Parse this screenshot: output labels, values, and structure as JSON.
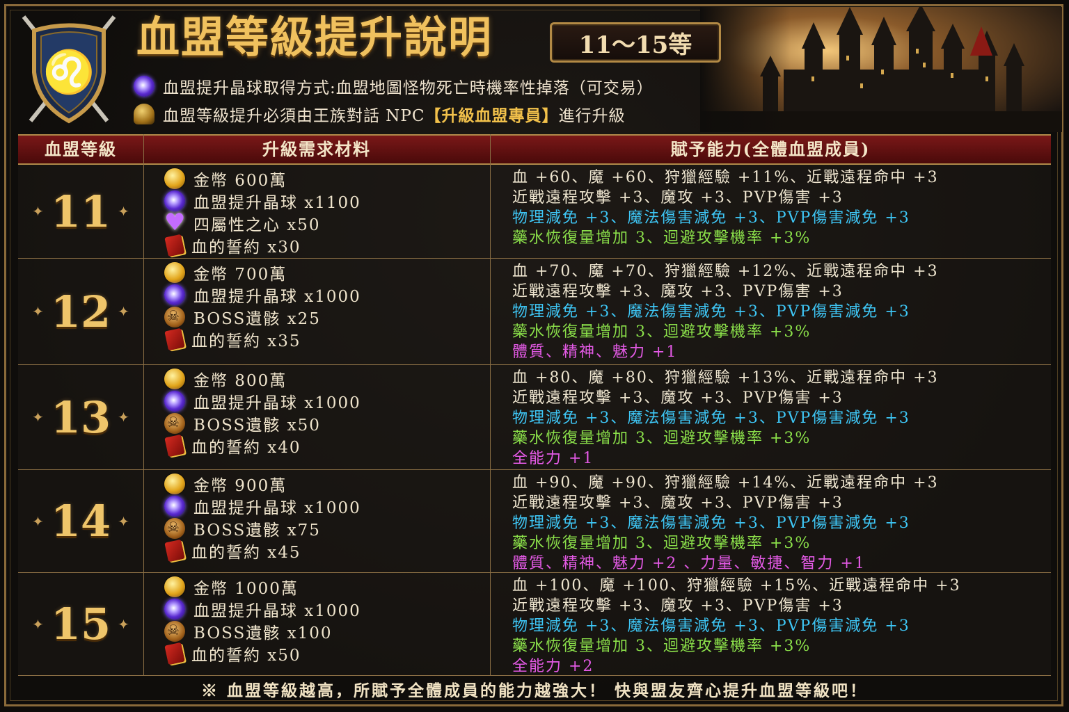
{
  "header": {
    "title": "血盟等級提升說明",
    "range_badge": "11～15等",
    "notes": [
      {
        "icon": "purple-orb-icon",
        "text": "血盟提升晶球取得方式:血盟地圖怪物死亡時機率性掉落（可交易）"
      },
      {
        "icon": "helmet-icon",
        "text_before": "血盟等級提升必須由王族對話 NPC",
        "highlight": "【升級血盟專員】",
        "text_after": " 進行升級"
      }
    ]
  },
  "table": {
    "headers": [
      "血盟等級",
      "升級需求材料",
      "賦予能力(全體血盟成員)"
    ],
    "rows": [
      {
        "level": "11",
        "materials": [
          {
            "icon": "gold-coin-icon",
            "text": "金幣 600萬"
          },
          {
            "icon": "purple-orb-icon",
            "text": "血盟提升晶球 x1100"
          },
          {
            "icon": "heart-gem-icon",
            "text": "四屬性之心 x50"
          },
          {
            "icon": "red-book-icon",
            "text": "血的誓約 x30"
          }
        ],
        "abilities": [
          {
            "color": "white",
            "text": "血 +60、魔 +60、狩獵經驗 +11%、近戰遠程命中 +3"
          },
          {
            "color": "white",
            "text": "近戰遠程攻擊 +3、魔攻 +3、PVP傷害 +3"
          },
          {
            "color": "blue",
            "text": "物理減免 +3、魔法傷害減免 +3、PVP傷害減免 +3"
          },
          {
            "color": "green",
            "text": "藥水恢復量增加 3、迴避攻擊機率 +3%"
          }
        ]
      },
      {
        "level": "12",
        "materials": [
          {
            "icon": "gold-coin-icon",
            "text": "金幣 700萬"
          },
          {
            "icon": "purple-orb-icon",
            "text": "血盟提升晶球 x1000"
          },
          {
            "icon": "skull-icon",
            "text": "BOSS遺骸 x25"
          },
          {
            "icon": "red-book-icon",
            "text": "血的誓約 x35"
          }
        ],
        "abilities": [
          {
            "color": "white",
            "text": "血 +70、魔 +70、狩獵經驗 +12%、近戰遠程命中 +3"
          },
          {
            "color": "white",
            "text": "近戰遠程攻擊 +3、魔攻 +3、PVP傷害 +3"
          },
          {
            "color": "blue",
            "text": "物理減免 +3、魔法傷害減免 +3、PVP傷害減免 +3"
          },
          {
            "color": "green",
            "text": "藥水恢復量增加 3、迴避攻擊機率 +3%"
          },
          {
            "color": "pink",
            "text": "體質、精神、魅力 +1"
          }
        ]
      },
      {
        "level": "13",
        "materials": [
          {
            "icon": "gold-coin-icon",
            "text": "金幣 800萬"
          },
          {
            "icon": "purple-orb-icon",
            "text": "血盟提升晶球 x1000"
          },
          {
            "icon": "skull-icon",
            "text": "BOSS遺骸 x50"
          },
          {
            "icon": "red-book-icon",
            "text": "血的誓約 x40"
          }
        ],
        "abilities": [
          {
            "color": "white",
            "text": "血 +80、魔 +80、狩獵經驗 +13%、近戰遠程命中 +3"
          },
          {
            "color": "white",
            "text": "近戰遠程攻擊 +3、魔攻 +3、PVP傷害 +3"
          },
          {
            "color": "blue",
            "text": "物理減免 +3、魔法傷害減免 +3、PVP傷害減免 +3"
          },
          {
            "color": "green",
            "text": "藥水恢復量增加 3、迴避攻擊機率 +3%"
          },
          {
            "color": "pink",
            "text": "全能力 +1"
          }
        ]
      },
      {
        "level": "14",
        "materials": [
          {
            "icon": "gold-coin-icon",
            "text": "金幣 900萬"
          },
          {
            "icon": "purple-orb-icon",
            "text": "血盟提升晶球 x1000"
          },
          {
            "icon": "skull-icon",
            "text": "BOSS遺骸 x75"
          },
          {
            "icon": "red-book-icon",
            "text": "血的誓約 x45"
          }
        ],
        "abilities": [
          {
            "color": "white",
            "text": "血 +90、魔 +90、狩獵經驗 +14%、近戰遠程命中 +3"
          },
          {
            "color": "white",
            "text": "近戰遠程攻擊 +3、魔攻 +3、PVP傷害 +3"
          },
          {
            "color": "blue",
            "text": "物理減免 +3、魔法傷害減免 +3、PVP傷害減免 +3"
          },
          {
            "color": "green",
            "text": "藥水恢復量增加 3、迴避攻擊機率 +3%"
          },
          {
            "color": "pink",
            "text": "體質、精神、魅力 +2 、力量、敏捷、智力 +1"
          }
        ]
      },
      {
        "level": "15",
        "materials": [
          {
            "icon": "gold-coin-icon",
            "text": "金幣 1000萬"
          },
          {
            "icon": "purple-orb-icon",
            "text": "血盟提升晶球 x1000"
          },
          {
            "icon": "skull-icon",
            "text": "BOSS遺骸 x100"
          },
          {
            "icon": "red-book-icon",
            "text": "血的誓約 x50"
          }
        ],
        "abilities": [
          {
            "color": "white",
            "text": "血 +100、魔 +100、狩獵經驗 +15%、近戰遠程命中 +3"
          },
          {
            "color": "white",
            "text": "近戰遠程攻擊 +3、魔攻 +3、PVP傷害 +3"
          },
          {
            "color": "blue",
            "text": "物理減免 +3、魔法傷害減免 +3、PVP傷害減免 +3"
          },
          {
            "color": "green",
            "text": "藥水恢復量增加 3、迴避攻擊機率 +3%"
          },
          {
            "color": "pink",
            "text": "全能力 +2"
          }
        ]
      }
    ]
  },
  "footer": "※ 血盟等級越高，所賦予全體成員的能力越強大！ 快與盟友齊心提升血盟等級吧！",
  "colors": {
    "gold": "#efc56a",
    "header_red": "#7a1818",
    "ability_white": "#efe6d0",
    "ability_blue": "#3ec6f5",
    "ability_green": "#8be04a",
    "ability_pink": "#e45ae6"
  }
}
